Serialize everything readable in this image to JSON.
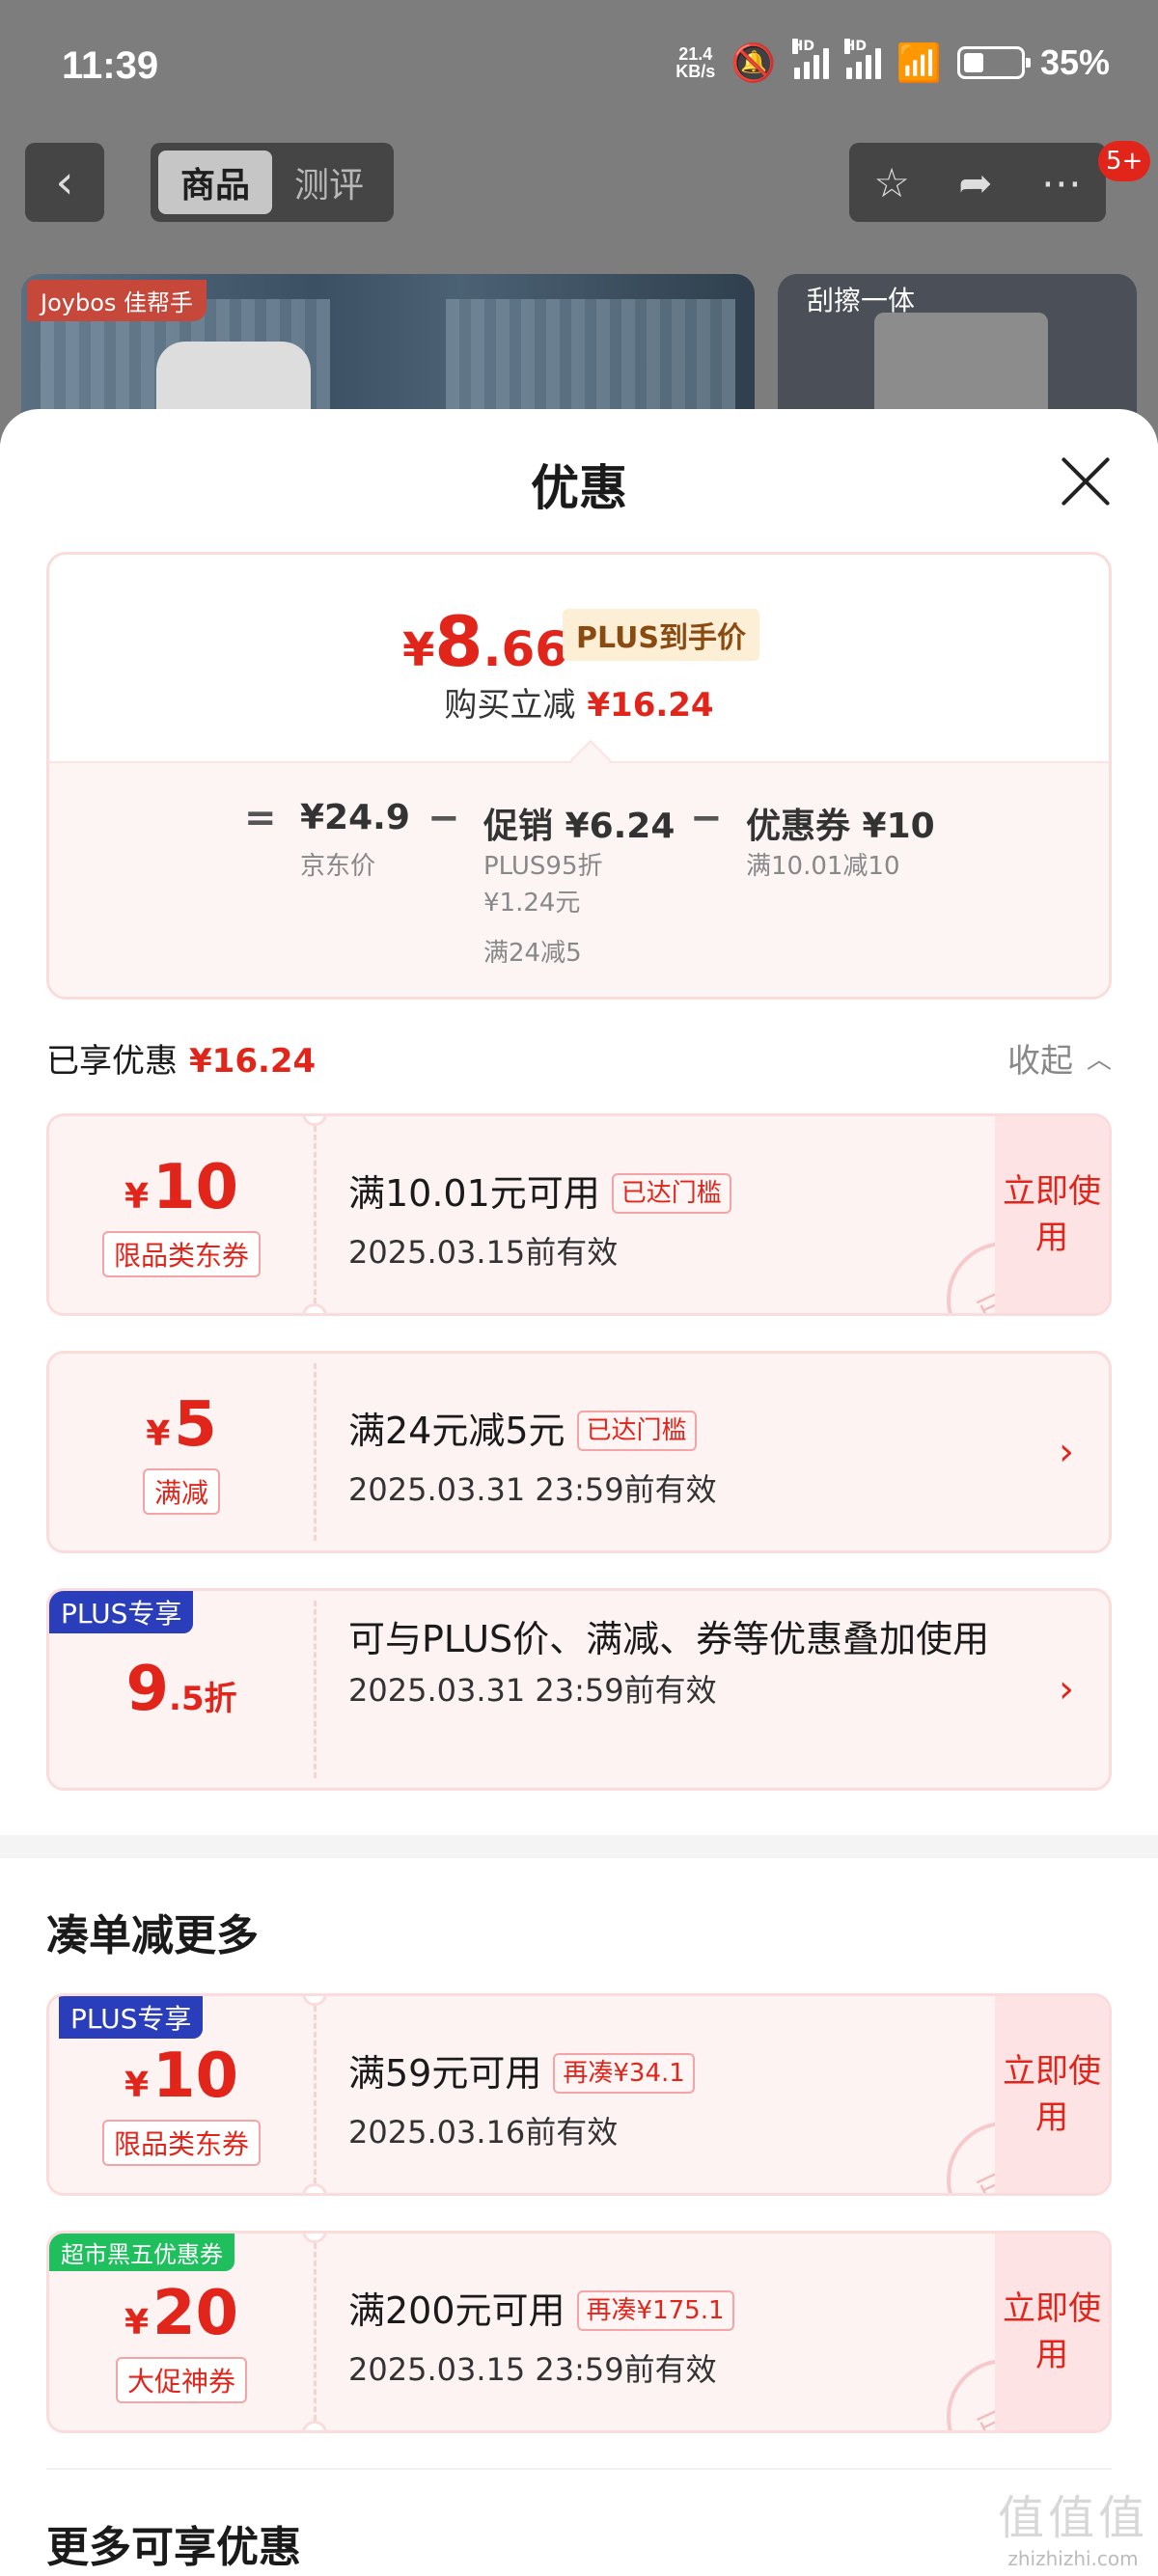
{
  "status_bar": {
    "time": "11:39",
    "net_speed_value": "21.4",
    "net_speed_unit": "KB/s",
    "battery_pct": "35%",
    "icons": [
      "mute-icon",
      "signal-icon",
      "signal-icon",
      "wifi-icon",
      "battery-icon"
    ]
  },
  "topbar": {
    "tabs": [
      "商品",
      "测评"
    ],
    "badge": "5+"
  },
  "background": {
    "brand": "Joybos 佳帮手",
    "caption": "刮擦一体"
  },
  "sheet": {
    "title": "优惠",
    "price": {
      "yen": "¥",
      "integer": "8",
      "decimal": ".66",
      "plus_tag": "PLUS到手价",
      "reduce_label": "购买立减",
      "reduce_amount": "¥16.24"
    },
    "calc": {
      "eq": "=",
      "minus": "−",
      "jd_price": "¥24.9",
      "jd_label": "京东价",
      "promo": "促销 ¥6.24",
      "promo_sub1": "PLUS95折",
      "promo_sub2": "¥1.24元",
      "promo_sub3": "满24减5",
      "coupon": "优惠券 ¥10",
      "coupon_sub": "满10.01减10"
    },
    "enjoyed_label": "已享优惠",
    "enjoyed_amount": "¥16.24",
    "collapse_label": "收起",
    "coupons": [
      {
        "yen": "¥",
        "amount": "10",
        "tag": "限品类东券",
        "condition": "满10.01元可用",
        "badge": "已达门槛",
        "date": "2025.03.15前有效",
        "action": "立即使用",
        "stamp": "已领"
      },
      {
        "yen": "¥",
        "amount": "5",
        "tag": "满减",
        "condition": "满24元减5元",
        "badge": "已达门槛",
        "date": "2025.03.31 23:59前有效"
      },
      {
        "corner": "PLUS专享",
        "amount": "9",
        "amount_small": ".5折",
        "condition": "可与PLUS价、满减、券等优惠叠加使用",
        "date": "2025.03.31 23:59前有效"
      }
    ],
    "more_title": "凑单减更多",
    "more_coupons": [
      {
        "corner": "PLUS专享",
        "yen": "¥",
        "amount": "10",
        "tag": "限品类东券",
        "condition": "满59元可用",
        "badge": "再凑¥34.1",
        "date": "2025.03.16前有效",
        "action": "立即使用",
        "stamp": "已领"
      },
      {
        "corner": "超市黑五优惠券",
        "yen": "¥",
        "amount": "20",
        "tag": "大促神券",
        "condition": "满200元可用",
        "badge": "再凑¥175.1",
        "date": "2025.03.15 23:59前有效",
        "action": "立即使用",
        "stamp": "已领"
      }
    ],
    "extra_title": "更多可享优惠"
  },
  "watermark": {
    "glyphs": "值值值",
    "site": "zhizhizhi.com"
  },
  "colors": {
    "accent": "#e1251b",
    "plus_blue": "#2a3dbb",
    "green": "#1fbf5e",
    "card_bg": "#fdf3f3",
    "border": "#fbdcdd"
  }
}
